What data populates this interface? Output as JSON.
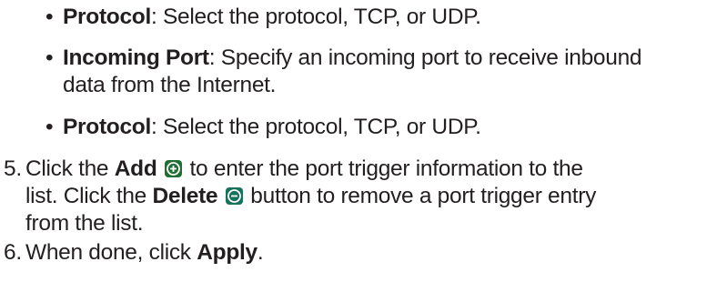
{
  "bullets": [
    {
      "marker": "•",
      "bold": "Protocol",
      "text": ": Select the protocol, TCP, or UDP."
    },
    {
      "marker": "•",
      "bold": "Incoming Port",
      "text_line1": ": Specify an incoming port to receive inbound",
      "text_line2": "data from the Internet."
    },
    {
      "marker": "•",
      "bold": "Protocol",
      "text": ": Select the protocol, TCP, or UDP."
    }
  ],
  "steps": [
    {
      "number": "5.",
      "part1": "Click the ",
      "bold_add": "Add",
      "part2": " to enter the port trigger information to the",
      "line2_part1": "list. Click the ",
      "bold_delete": "Delete",
      "line2_part2": " button to remove a port trigger entry",
      "line3": "from the list."
    },
    {
      "number": "6.",
      "part1": "When done, click ",
      "bold_apply": "Apply",
      "part2": "."
    }
  ],
  "icons": {
    "add": "add-circle-icon",
    "delete": "remove-circle-icon",
    "add_color": "#1f6f33",
    "delete_color": "#17715d"
  }
}
